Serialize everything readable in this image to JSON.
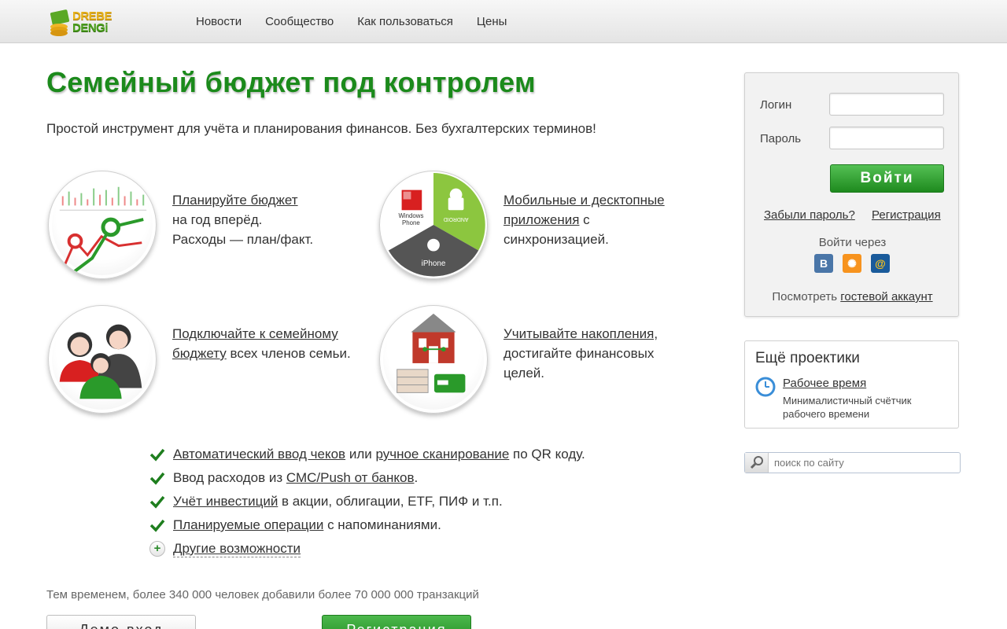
{
  "brand": {
    "line1": "DREBE",
    "line2": "DENGi"
  },
  "nav": {
    "items": [
      "Новости",
      "Сообщество",
      "Как пользоваться",
      "Цены"
    ]
  },
  "hero": {
    "title": "Семейный бюджет под контролем",
    "subtitle": "Простой инструмент для учёта и планирования финансов. Без бухгалтерских терминов!"
  },
  "features": {
    "plan": {
      "link": "Планируйте бюджет",
      "line2": "на год вперёд.",
      "line3": "Расходы — план/факт."
    },
    "mobile": {
      "link1": "Мобильные и десктопные",
      "link2": "приложения",
      "rest1": " с",
      "rest2": "синхронизацией.",
      "label_wp1": "Windows",
      "label_wp2": "Phone",
      "label_android": "ANDROID",
      "label_iphone": "iPhone"
    },
    "family": {
      "link1": "Подключайте к семейному",
      "link2": "бюджету",
      "rest": " всех членов семьи."
    },
    "savings": {
      "link": "Учитывайте накопления,",
      "line2": "достигайте финансовых",
      "line3": "целей."
    }
  },
  "checklist": [
    {
      "link1": "Автоматический ввод чеков",
      "mid": " или ",
      "link2": "ручное сканирование",
      "rest": " по QR коду."
    },
    {
      "pre": "Ввод расходов из ",
      "link": "СМС/Push от банков",
      "rest": "."
    },
    {
      "link": "Учёт инвестиций",
      "rest": " в акции, облигации, ETF, ПИФ и т.п."
    },
    {
      "link": "Планируемые операции",
      "rest": " с напоминаниями."
    }
  ],
  "more_features": "Другие возможности",
  "stats": "Тем временем, более 340 000 человек добавили более 70 000 000 транзакций",
  "buttons": {
    "demo": "Демо-вход",
    "register": "Регистрация"
  },
  "login": {
    "login_label": "Логин",
    "password_label": "Пароль",
    "submit": "Войти",
    "forgot": "Забыли пароль?",
    "register": "Регистрация",
    "via": "Войти через",
    "social": [
      "В",
      "✺",
      "@"
    ],
    "guest_pre": "Посмотреть ",
    "guest_link": "гостевой аккаунт"
  },
  "projects": {
    "title": "Ещё проектики",
    "item_link": "Рабочее время",
    "item_desc": "Минималистичный счётчик рабочего времени"
  },
  "search": {
    "placeholder": "поиск по сайту"
  },
  "colors": {
    "brand_green": "#1b8a1b",
    "button_green": "#2a9a2a",
    "vk_blue": "#4a76a8",
    "ok_orange": "#f7931e",
    "mail_blue": "#1a5b9b"
  }
}
